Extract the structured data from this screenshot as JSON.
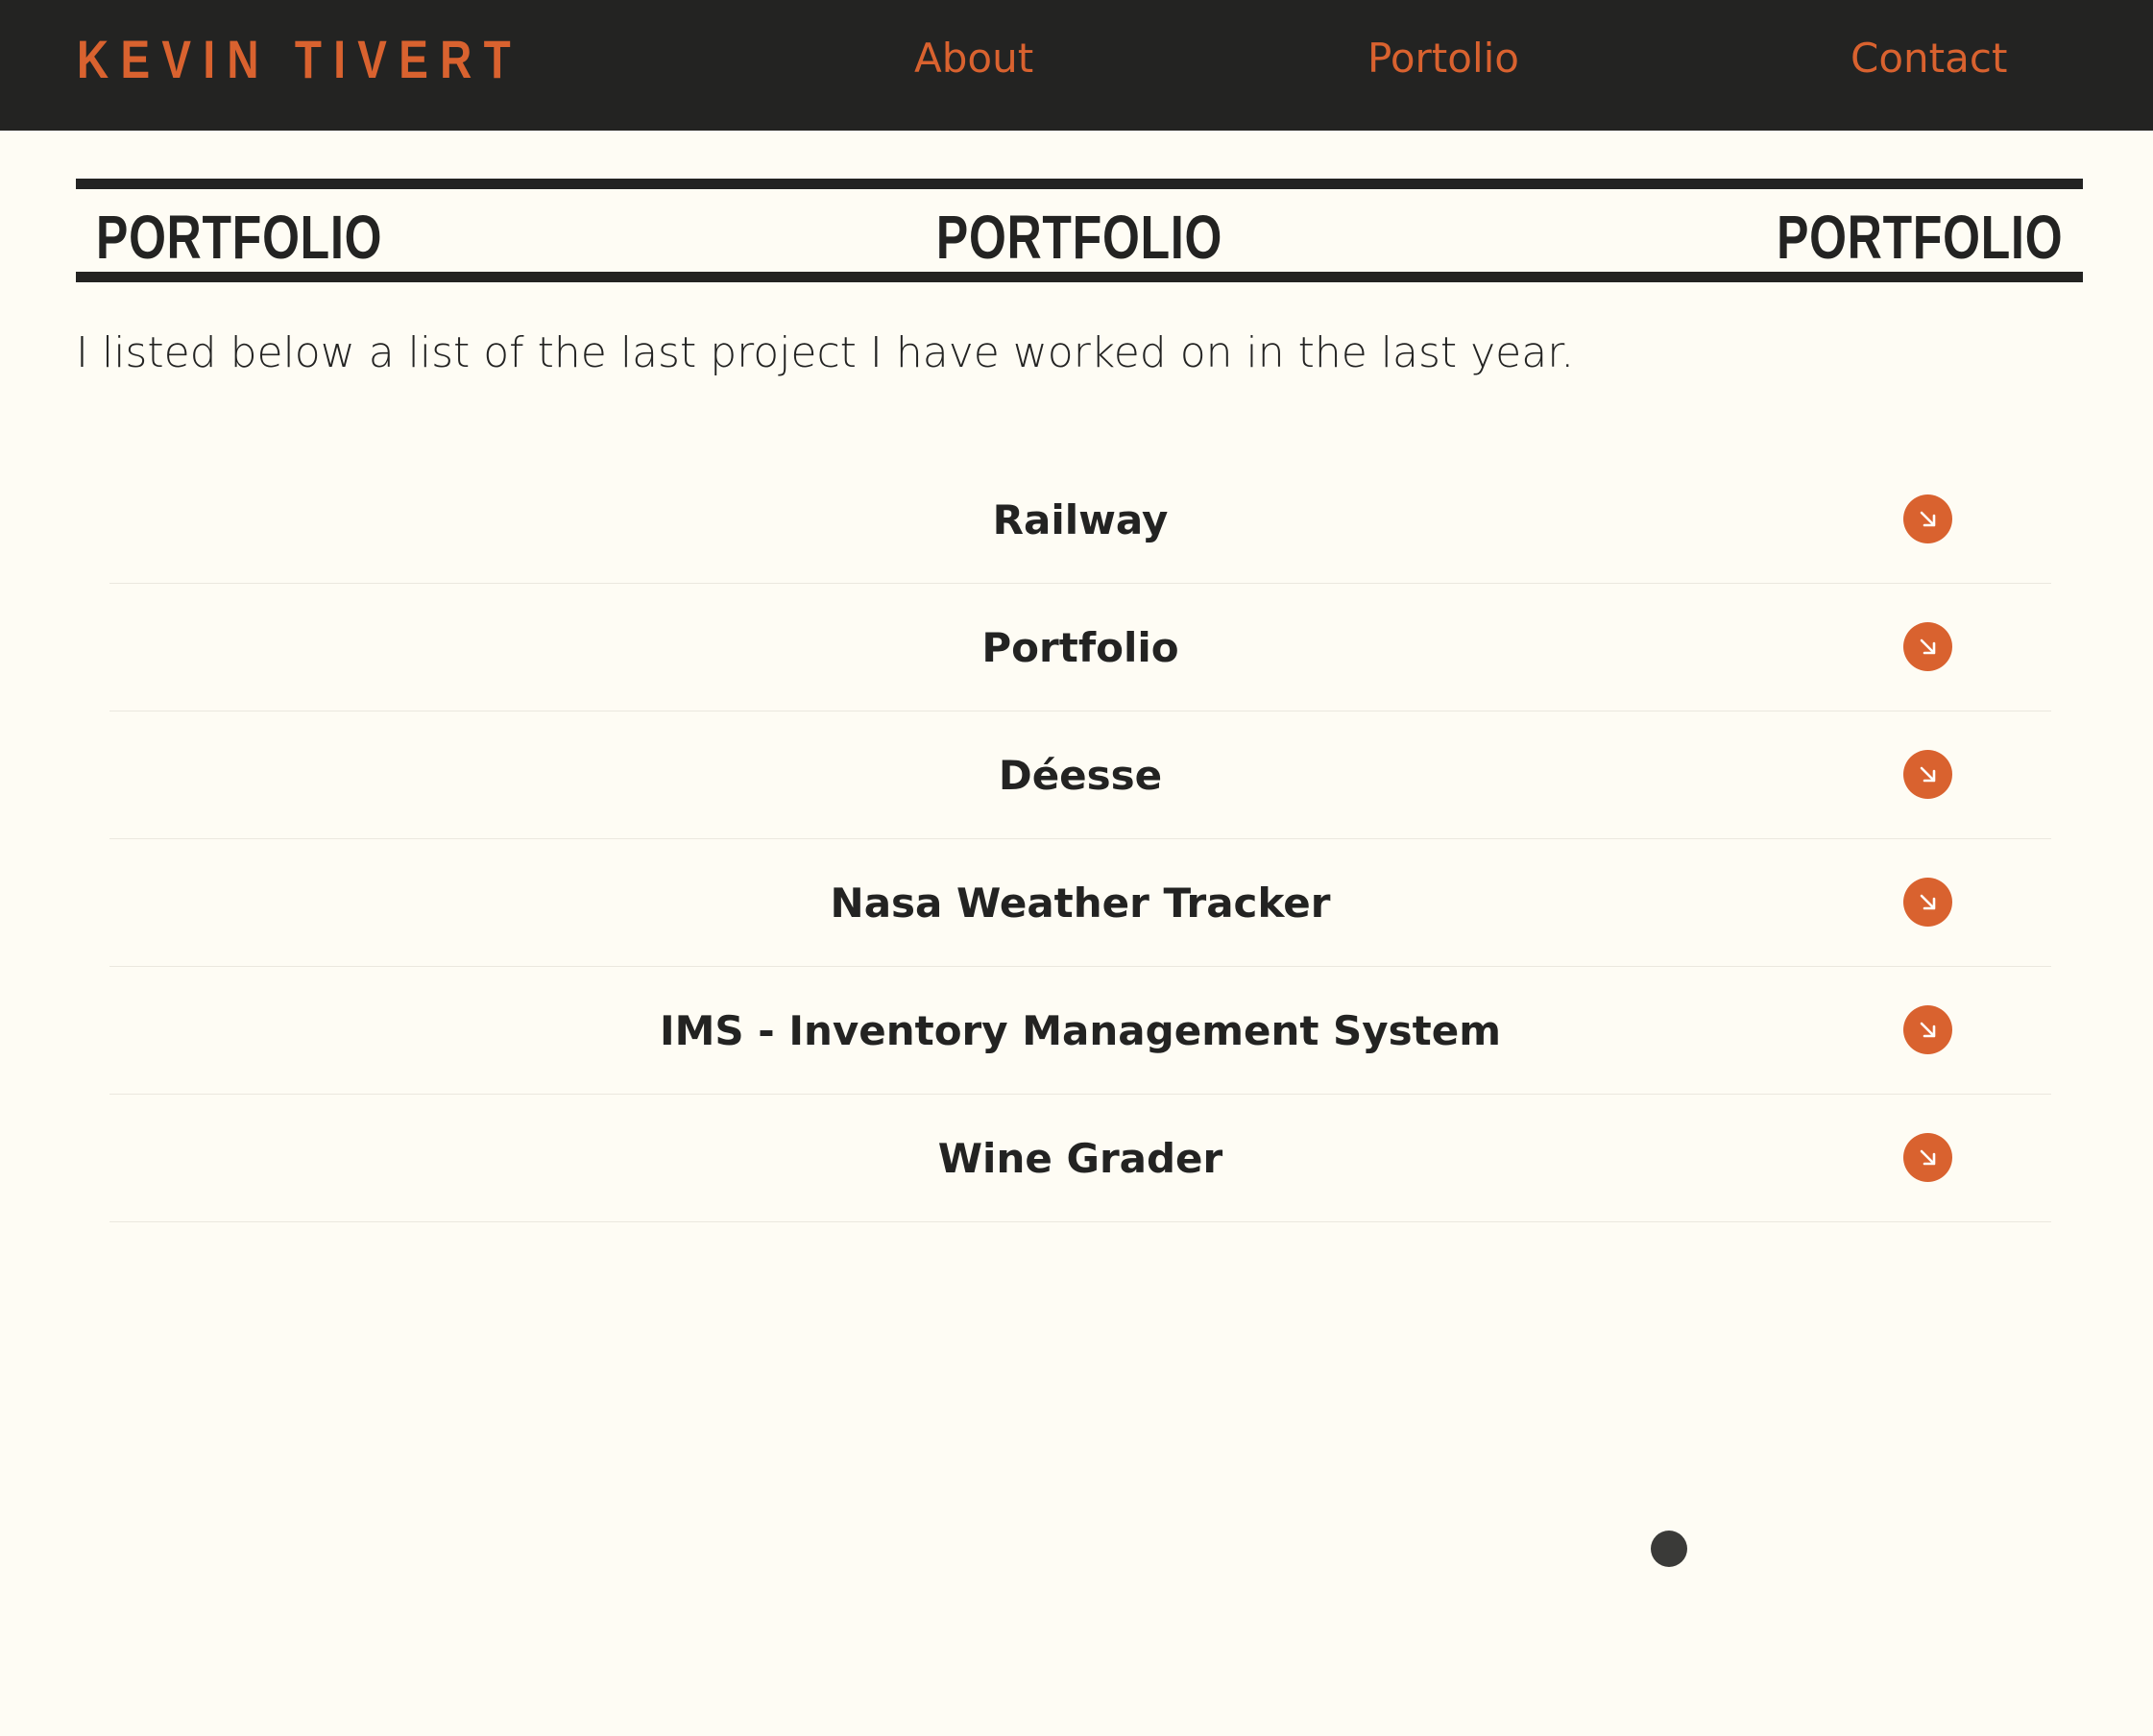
{
  "header": {
    "brand": "KEVIN TIVERT",
    "nav": [
      {
        "label": "About"
      },
      {
        "label": "Portolio"
      },
      {
        "label": "Contact"
      }
    ]
  },
  "banner": {
    "words": [
      "PORTFOLIO",
      "PORTFOLIO",
      "PORTFOLIO"
    ]
  },
  "intro": "I listed below a list of the last project I have worked on in the last year.",
  "projects": [
    {
      "name": "Railway"
    },
    {
      "name": "Portfolio"
    },
    {
      "name": "Déesse"
    },
    {
      "name": "Nasa Weather Tracker"
    },
    {
      "name": "IMS - Inventory Management System"
    },
    {
      "name": "Wine Grader"
    }
  ],
  "colors": {
    "accent": "#d9622f",
    "header_bg": "#232322",
    "page_bg": "#fefcf4",
    "text": "#232322"
  },
  "icons": {
    "project_link": "arrow-down-right-icon"
  }
}
